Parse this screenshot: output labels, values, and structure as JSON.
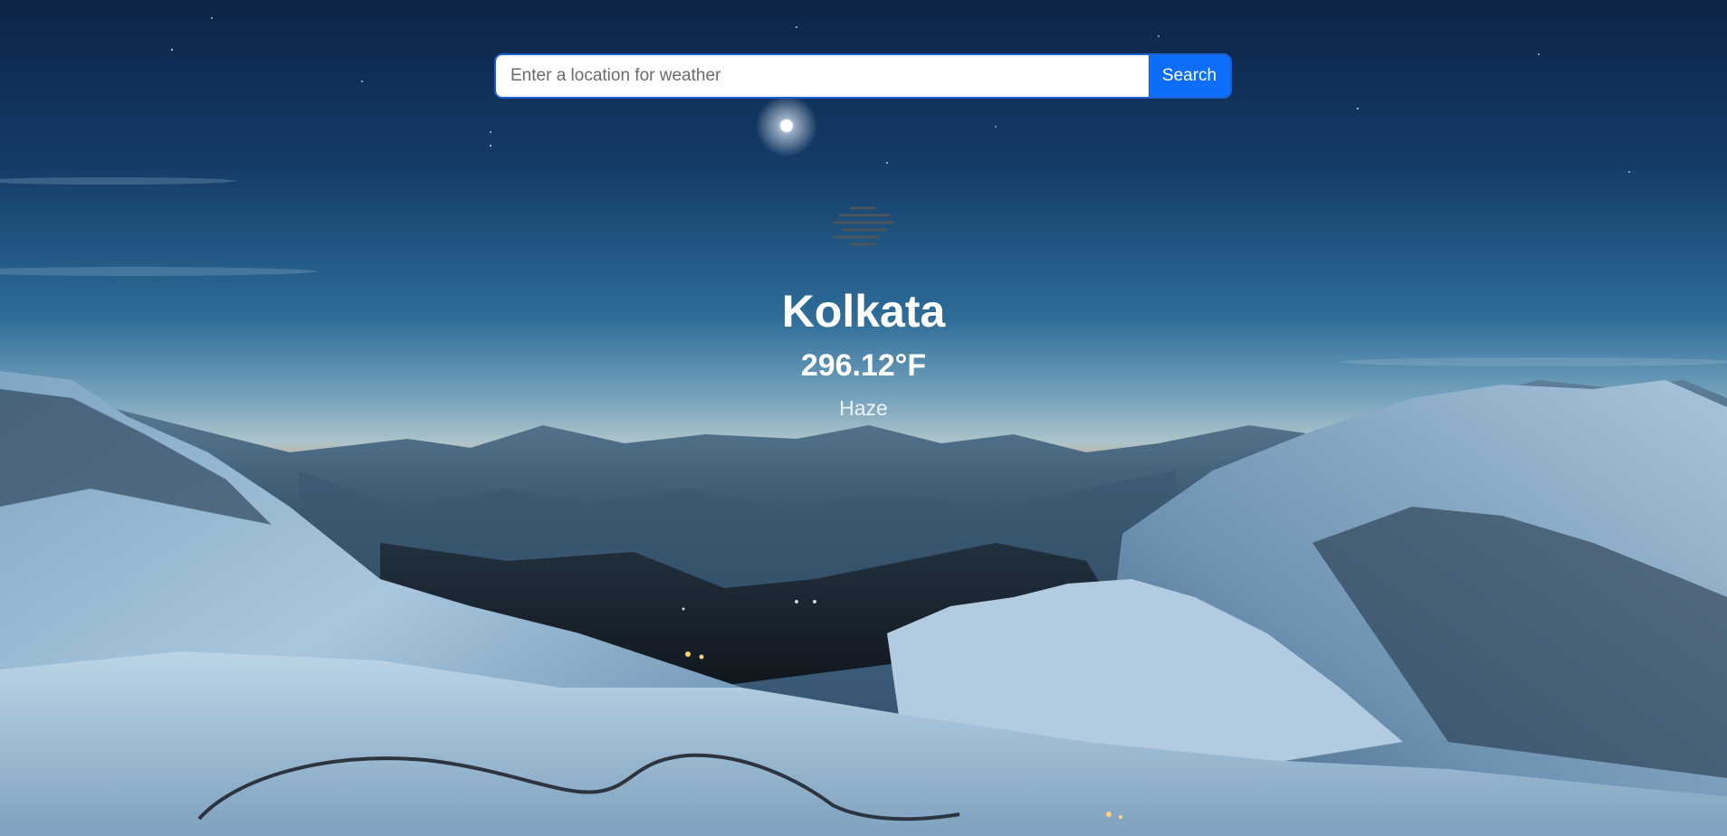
{
  "search": {
    "placeholder": "Enter a location for weather",
    "value": "",
    "button_label": "Search"
  },
  "weather": {
    "icon": "haze-icon",
    "city": "Kolkata",
    "temperature": "296.12°F",
    "description": "Haze"
  },
  "colors": {
    "search_button": "#0d6efd",
    "input_border": "#1f5fd6",
    "text": "#ffffff"
  }
}
